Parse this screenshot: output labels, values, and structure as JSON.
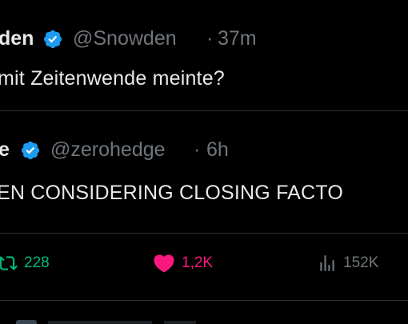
{
  "tweets": [
    {
      "name_fragment": "den",
      "handle": "@Snowden",
      "separator": "·",
      "time": "37m",
      "text": "mit Zeitenwende meinte?"
    },
    {
      "name_fragment": "e",
      "handle": "@zerohedge",
      "separator": "·",
      "time": "6h",
      "text": "EN CONSIDERING CLOSING FACTO"
    }
  ],
  "actions": {
    "retweets": "228",
    "likes": "1,2K",
    "views": "152K"
  },
  "icons": {
    "verified": "verified-badge-icon",
    "retweet": "retweet-icon",
    "like": "heart-icon",
    "views": "views-bar-chart-icon"
  },
  "colors": {
    "background": "#000000",
    "text": "#e7e9ea",
    "muted": "#71767b",
    "verified": "#1d9bf0",
    "retweet": "#00ba7c",
    "like": "#f91880",
    "divider": "#2f3336"
  }
}
